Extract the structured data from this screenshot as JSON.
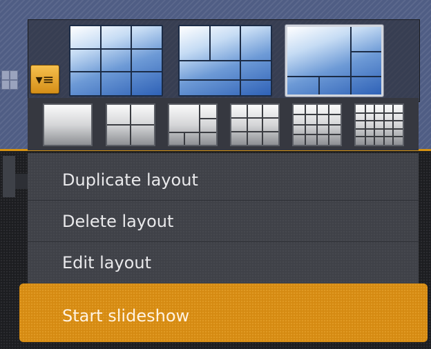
{
  "layout_picker": {
    "menu_button_icon": "list-menu-icon",
    "large_layouts": [
      {
        "name": "grid-3x3"
      },
      {
        "name": "grid-2x2-plus-row"
      },
      {
        "name": "big-plus-side",
        "selected": true
      }
    ],
    "small_layouts": [
      {
        "name": "single"
      },
      {
        "name": "2x2"
      },
      {
        "name": "1-plus-5"
      },
      {
        "name": "3x3"
      },
      {
        "name": "4x4"
      },
      {
        "name": "5x5"
      }
    ]
  },
  "menu": {
    "items": [
      {
        "label": "Duplicate layout"
      },
      {
        "label": "Delete layout"
      },
      {
        "label": "Edit layout"
      }
    ],
    "highlighted_item": {
      "label": "Start slideshow"
    }
  },
  "colors": {
    "accent": "#d58a12",
    "menu_bg": "#3f4148",
    "menu_text": "#e9e9eb",
    "layout_blue": "#2f62b7"
  }
}
